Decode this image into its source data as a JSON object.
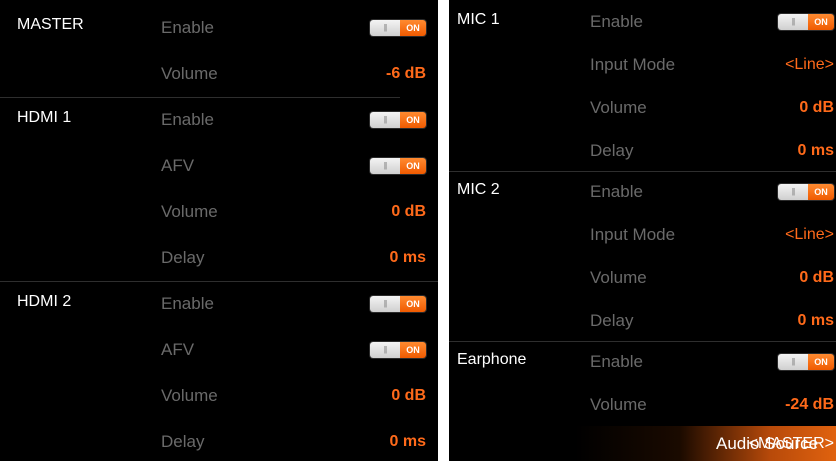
{
  "left": {
    "master": {
      "title": "MASTER",
      "enable_label": "Enable",
      "enable_toggle": "ON",
      "volume_label": "Volume",
      "volume_value": "-6 dB"
    },
    "hdmi1": {
      "title": "HDMI 1",
      "enable_label": "Enable",
      "enable_toggle": "ON",
      "afv_label": "AFV",
      "afv_toggle": "ON",
      "volume_label": "Volume",
      "volume_value": "0 dB",
      "delay_label": "Delay",
      "delay_value": "0 ms"
    },
    "hdmi2": {
      "title": "HDMI 2",
      "enable_label": "Enable",
      "enable_toggle": "ON",
      "afv_label": "AFV",
      "afv_toggle": "ON",
      "volume_label": "Volume",
      "volume_value": "0 dB",
      "delay_label": "Delay",
      "delay_value": "0 ms"
    }
  },
  "right": {
    "mic1": {
      "title": "MIC 1",
      "enable_label": "Enable",
      "enable_toggle": "ON",
      "input_mode_label": "Input Mode",
      "input_mode_value": "<Line>",
      "volume_label": "Volume",
      "volume_value": "0 dB",
      "delay_label": "Delay",
      "delay_value": "0 ms"
    },
    "mic2": {
      "title": "MIC 2",
      "enable_label": "Enable",
      "enable_toggle": "ON",
      "input_mode_label": "Input Mode",
      "input_mode_value": "<Line>",
      "volume_label": "Volume",
      "volume_value": "0 dB",
      "delay_label": "Delay",
      "delay_value": "0 ms"
    },
    "earphone": {
      "title": "Earphone",
      "enable_label": "Enable",
      "enable_toggle": "ON",
      "volume_label": "Volume",
      "volume_value": "-24 dB",
      "audio_source_label": "Audio Source",
      "audio_source_value": "<MASTER>"
    }
  },
  "toggle_grip_icon": "grip-icon",
  "colors": {
    "background": "#000000",
    "accent": "#ff6a1a",
    "label_dim": "#6a6a6a",
    "title": "#ffffff",
    "highlight_gradient_end": "#e0620f"
  }
}
